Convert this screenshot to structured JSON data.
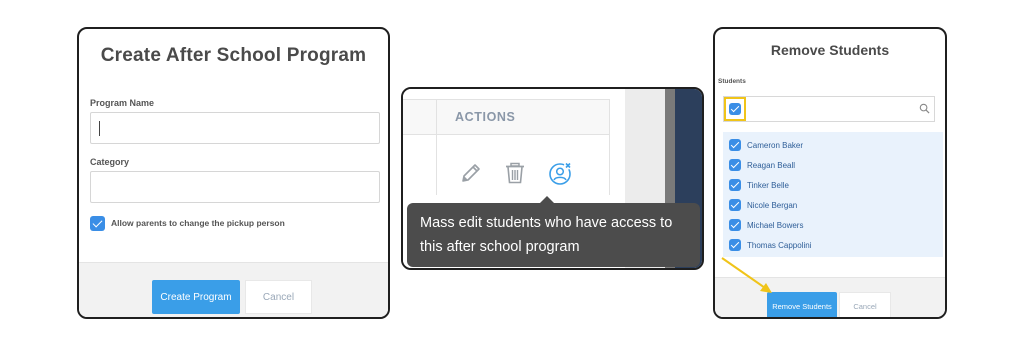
{
  "create_program": {
    "title": "Create After School Program",
    "program_name_label": "Program Name",
    "program_name_value": "",
    "category_label": "Category",
    "category_value": "",
    "allow_parents_checked": true,
    "allow_parents_label": "Allow parents to change the pickup person",
    "create_button": "Create Program",
    "cancel_button": "Cancel"
  },
  "actions_panel": {
    "column_header": "ACTIONS",
    "icons": [
      "pencil-icon",
      "trash-icon",
      "user-remove-icon"
    ],
    "tooltip_line1": "Mass edit students who have access to",
    "tooltip_line2": "this after school program"
  },
  "remove_students": {
    "title": "Remove Students",
    "students_label": "Students",
    "select_all_checked": true,
    "search_value": "",
    "students": [
      {
        "name": "Cameron Baker",
        "checked": true
      },
      {
        "name": "Reagan Beall",
        "checked": true
      },
      {
        "name": "Tinker Belle",
        "checked": true
      },
      {
        "name": "Nicole Bergan",
        "checked": true
      },
      {
        "name": "Michael Bowers",
        "checked": true
      },
      {
        "name": "Thomas Cappolini",
        "checked": true
      }
    ],
    "remove_button": "Remove Students",
    "cancel_button": "Cancel"
  },
  "colors": {
    "primary": "#3a9ee8",
    "checkbox": "#3a8ee6",
    "highlight": "#f0c419",
    "tooltip_bg": "#4c4c4c",
    "list_bg": "#e9f2fc"
  }
}
